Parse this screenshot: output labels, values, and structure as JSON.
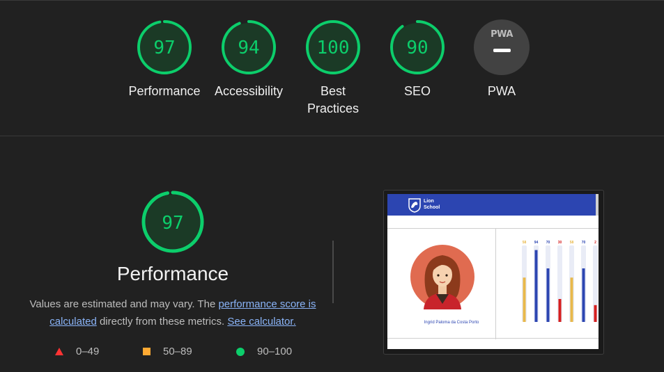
{
  "categories": [
    {
      "id": "performance",
      "score": "97",
      "label": "Performance",
      "fraction": 0.97
    },
    {
      "id": "accessibility",
      "score": "94",
      "label": "Accessibility",
      "fraction": 0.94
    },
    {
      "id": "best-practices",
      "score": "100",
      "label": "Best Practices",
      "fraction": 1.0
    },
    {
      "id": "seo",
      "score": "90",
      "label": "SEO",
      "fraction": 0.9
    },
    {
      "id": "pwa",
      "score": "",
      "label": "PWA",
      "logo": "PWA"
    }
  ],
  "performance_section": {
    "score": "97",
    "score_fraction": 0.97,
    "title": "Performance",
    "desc_prefix": "Values are estimated and may vary. The ",
    "link_score": "performance score is calculated",
    "desc_middle": " directly from these metrics. ",
    "link_calculator": "See calculator."
  },
  "legend": [
    {
      "shape": "triangle",
      "range": "0–49",
      "color": "#ff3333"
    },
    {
      "shape": "square",
      "range": "50–89",
      "color": "#ffaa33"
    },
    {
      "shape": "circle",
      "range": "90–100",
      "color": "#0cce6b"
    }
  ],
  "screenshot": {
    "brand_line1": "Lion",
    "brand_line2": "School",
    "student_name": "Ingrid Paloma da Costa Porto",
    "bars": [
      {
        "label": "58",
        "value": 58,
        "color": "#e8b84a"
      },
      {
        "label": "94",
        "value": 94,
        "color": "#2c45b1"
      },
      {
        "label": "70",
        "value": 70,
        "color": "#2c45b1"
      },
      {
        "label": "30",
        "value": 30,
        "color": "#d61f1f"
      },
      {
        "label": "58",
        "value": 58,
        "color": "#e8b84a"
      },
      {
        "label": "70",
        "value": 70,
        "color": "#2c45b1"
      },
      {
        "label": "2",
        "value": 22,
        "color": "#d61f1f"
      }
    ]
  },
  "colors": {
    "pass": "#0cce6b",
    "pass_bg": "#1b3a26",
    "background": "#212121"
  }
}
